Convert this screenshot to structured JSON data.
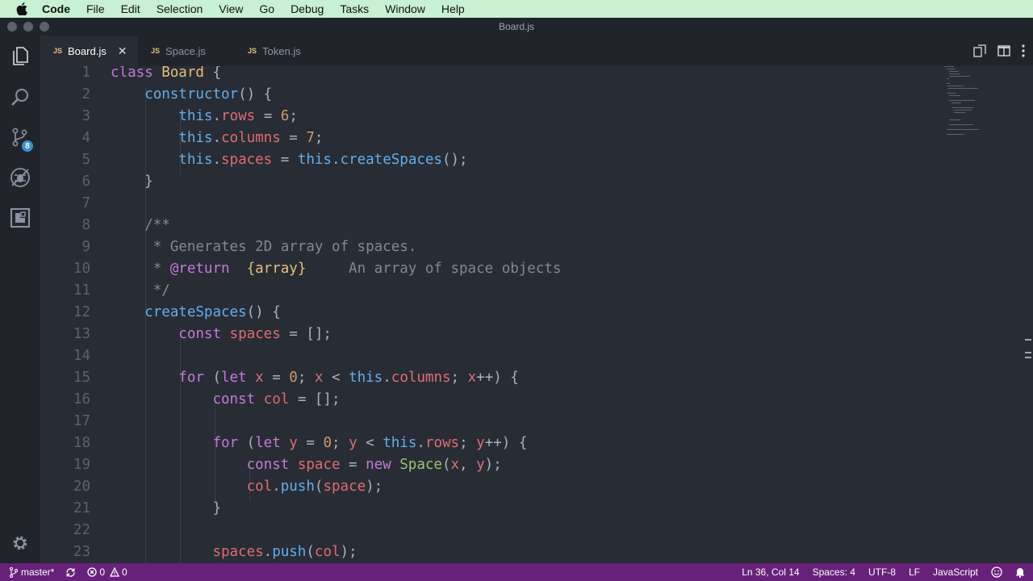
{
  "menubar": {
    "items": [
      "Code",
      "File",
      "Edit",
      "Selection",
      "View",
      "Go",
      "Debug",
      "Tasks",
      "Window",
      "Help"
    ]
  },
  "window": {
    "title": "Board.js"
  },
  "activity": {
    "scm_badge": "8"
  },
  "tabs": [
    {
      "label": "Board.js",
      "icon": "JS",
      "active": true
    },
    {
      "label": "Space.js",
      "icon": "JS",
      "active": false
    },
    {
      "label": "Token.js",
      "icon": "JS",
      "active": false
    }
  ],
  "editor": {
    "line_numbers": [
      "1",
      "2",
      "3",
      "4",
      "5",
      "6",
      "7",
      "8",
      "9",
      "10",
      "11",
      "12",
      "13",
      "14",
      "15",
      "16",
      "17",
      "18",
      "19",
      "20",
      "21",
      "22",
      "23"
    ],
    "tokens": {
      "l1": [
        "class",
        "Board",
        "{"
      ],
      "l2": [
        "constructor",
        "() {"
      ],
      "l3": [
        "this",
        ".",
        "rows",
        " = ",
        "6",
        ";"
      ],
      "l4": [
        "this",
        ".",
        "columns",
        " = ",
        "7",
        ";"
      ],
      "l5": [
        "this",
        ".",
        "spaces",
        " = ",
        "this",
        ".",
        "createSpaces",
        "();"
      ],
      "l6": [
        "}"
      ],
      "l8": [
        "/**"
      ],
      "l9": [
        "* Generates 2D array of spaces."
      ],
      "l10": [
        "* ",
        "@return",
        "  ",
        "{array}",
        "     An array of space objects"
      ],
      "l11": [
        "*/"
      ],
      "l12": [
        "createSpaces",
        "() {"
      ],
      "l13": [
        "const",
        "spaces",
        " = [];"
      ],
      "l15": [
        "for",
        " (",
        "let",
        "x",
        " = ",
        "0",
        "; ",
        "x",
        " < ",
        "this",
        ".",
        "columns",
        "; ",
        "x",
        "++) {"
      ],
      "l16": [
        "const",
        "col",
        " = [];"
      ],
      "l18": [
        "for",
        " (",
        "let",
        "y",
        " = ",
        "0",
        "; ",
        "y",
        " < ",
        "this",
        ".",
        "rows",
        "; ",
        "y",
        "++) {"
      ],
      "l19": [
        "const",
        "space",
        " = ",
        "new",
        "Space",
        "(",
        "x",
        ", ",
        "y",
        ");"
      ],
      "l20": [
        "col",
        ".",
        "push",
        "(",
        "space",
        ");"
      ],
      "l21": [
        "}"
      ],
      "l23": [
        "spaces",
        ".",
        "push",
        "(",
        "col",
        ");"
      ]
    }
  },
  "statusbar": {
    "branch": "master*",
    "errors": "0",
    "warnings": "0",
    "position": "Ln 36, Col 14",
    "spaces": "Spaces: 4",
    "encoding": "UTF-8",
    "eol": "LF",
    "language": "JavaScript"
  }
}
